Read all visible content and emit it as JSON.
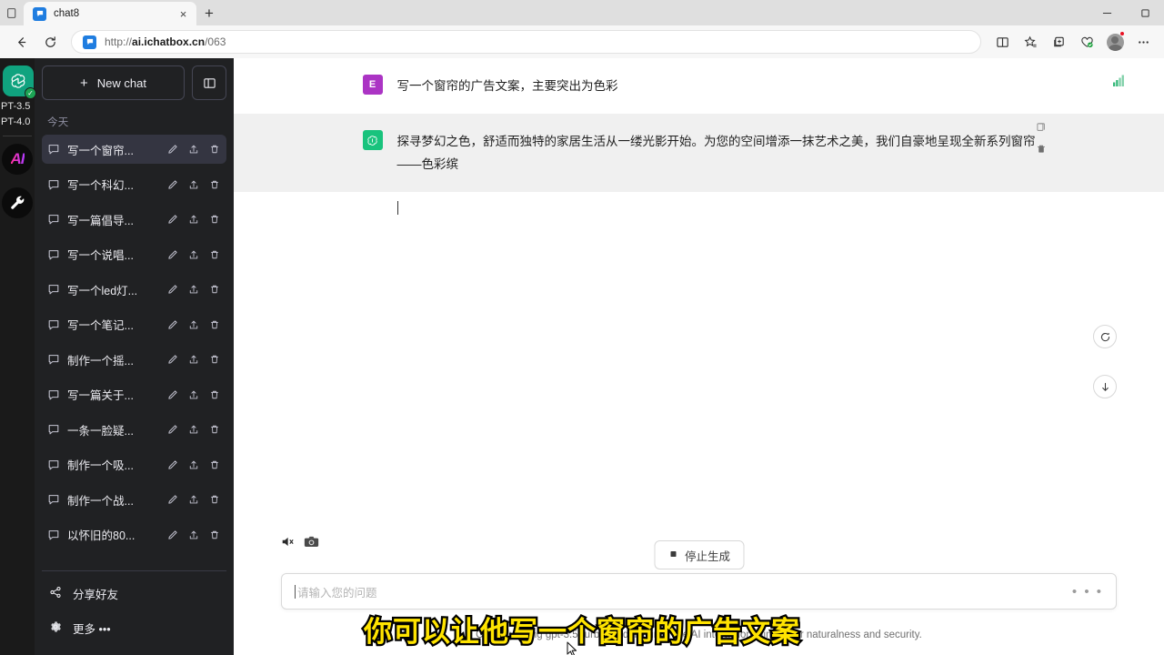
{
  "browser": {
    "tab": {
      "title": "chat8",
      "favicon": "chat-bubble-icon",
      "close_label": "×"
    },
    "newtab_label": "+",
    "window_controls": {
      "minimize": "—",
      "maximize": "❐"
    },
    "nav": {
      "back_icon": "back-arrow-icon",
      "reload_icon": "reload-icon",
      "url_prefix": "http://",
      "url_domain": "ai.ichatbox.cn",
      "url_path": "/063",
      "right_icons": [
        "split-screen-icon",
        "favorites-star-icon",
        "collections-icon",
        "browser-essentials-icon",
        "profile-avatar",
        "settings-more-icon"
      ]
    }
  },
  "rail": {
    "logo_name": "openai-logo",
    "badge": "✓",
    "labels": [
      "PT-3.5",
      "PT-4.0"
    ],
    "ai_label": "AI",
    "tool_icon": "wrench-icon"
  },
  "sidebar": {
    "new_chat_label": "New chat",
    "new_chat_plus": "+",
    "collapse_icon": "sidebar-toggle-icon",
    "section_title": "今天",
    "row_actions": {
      "edit": "edit-icon",
      "share": "share-icon",
      "delete": "trash-icon"
    },
    "items": [
      {
        "label": "写一个窗帘...",
        "active": true
      },
      {
        "label": "写一个科幻...",
        "active": false
      },
      {
        "label": "写一篇倡导...",
        "active": false
      },
      {
        "label": "写一个说唱...",
        "active": false
      },
      {
        "label": "写一个led灯...",
        "active": false
      },
      {
        "label": "写一个笔记...",
        "active": false
      },
      {
        "label": "制作一个摇...",
        "active": false
      },
      {
        "label": "写一篇关于...",
        "active": false
      },
      {
        "label": "一条一脸疑...",
        "active": false
      },
      {
        "label": "制作一个吸...",
        "active": false
      },
      {
        "label": "制作一个战...",
        "active": false
      },
      {
        "label": "以怀旧的80...",
        "active": false
      }
    ],
    "footer": [
      {
        "label": "分享好友",
        "icon": "share-icon"
      },
      {
        "label": "更多 •••",
        "icon": "gear-icon"
      }
    ]
  },
  "chat": {
    "messages": [
      {
        "role": "user",
        "avatar_letter": "E",
        "avatar_color": "#ab34c4",
        "text": "写一个窗帘的广告文案，主要突出为色彩"
      },
      {
        "role": "assistant",
        "avatar_letter": "",
        "avatar_color": "#19c37d",
        "text": "探寻梦幻之色，舒适而独特的家居生活从一缕光影开始。为您的空间增添一抹艺术之美，我们自豪地呈现全新系列窗帘——色彩缤"
      }
    ],
    "signal_icon": "signal-bars-icon",
    "bot_actions": {
      "copy": "copy-icon",
      "delete": "trash-icon"
    },
    "float_buttons": {
      "regenerate": "refresh-icon",
      "scroll_down": "arrow-down-icon"
    }
  },
  "composer": {
    "stop_label": "停止生成",
    "stop_icon": "stop-icon",
    "media_icons": [
      "speaker-muted-icon",
      "camera-icon",
      "record-icon"
    ],
    "placeholder": "请输入您的问题",
    "more_dots": "• • •",
    "footnote": "Curently using gpt-3.5-turbo model to improve AI interaction, aiming for naturalness and security."
  },
  "overlay": {
    "subtitle": "你可以让他写一个窗帘的广告文案",
    "subtitle_color": "#ffe400"
  }
}
